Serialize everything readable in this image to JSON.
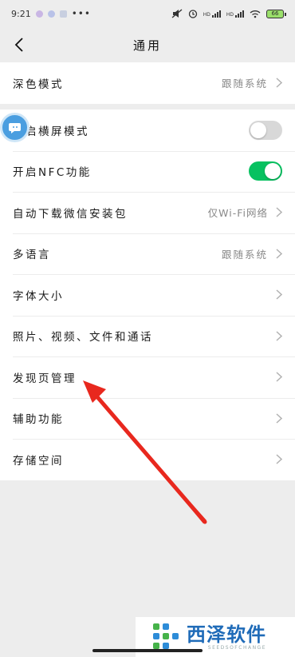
{
  "status_bar": {
    "time": "9:21",
    "signal1_label": "HD",
    "signal2_label": "HD",
    "battery": "66"
  },
  "header": {
    "title": "通用"
  },
  "group1": [
    {
      "label": "深色模式",
      "value": "跟随系统"
    }
  ],
  "group2": [
    {
      "label": "开启横屏模式",
      "toggle": "off"
    },
    {
      "label": "开启NFC功能",
      "toggle": "on"
    },
    {
      "label": "自动下载微信安装包",
      "value": "仅Wi-Fi网络"
    },
    {
      "label": "多语言",
      "value": "跟随系统"
    },
    {
      "label": "字体大小"
    },
    {
      "label": "照片、视频、文件和通话"
    },
    {
      "label": "发现页管理"
    },
    {
      "label": "辅助功能"
    },
    {
      "label": "存储空间"
    }
  ],
  "watermark": {
    "main": "西泽软件",
    "sub": "SEEDSOFCHANGE"
  },
  "colors": {
    "toggle_on": "#07c160",
    "toggle_off": "#d8d8d8",
    "arrow": "#e8281e",
    "background": "#ededed"
  }
}
